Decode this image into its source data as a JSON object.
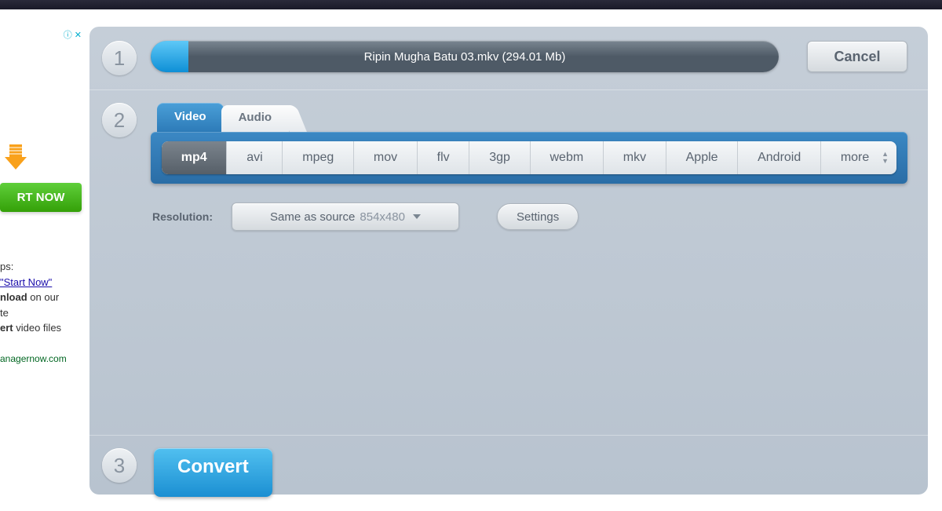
{
  "ad": {
    "badge_info": "ⓘ",
    "badge_close": "✕",
    "start_now": "RT NOW",
    "line_ps": "ps:",
    "link_start": "\"Start Now\"",
    "line2a": "nload",
    "line2b": " on our",
    "line3": "te",
    "line4a": "ert",
    "line4b": " video files",
    "domain": "anagernow.com"
  },
  "step1": {
    "num": "1",
    "file_label": "Ripin Mugha Batu 03.mkv (294.01 Mb)",
    "cancel": "Cancel"
  },
  "step2": {
    "num": "2",
    "tabs": {
      "video": "Video",
      "audio": "Audio"
    },
    "formats": {
      "mp4": "mp4",
      "avi": "avi",
      "mpeg": "mpeg",
      "mov": "mov",
      "flv": "flv",
      "gp3": "3gp",
      "webm": "webm",
      "mkv": "mkv",
      "apple": "Apple",
      "android": "Android",
      "more": "more"
    },
    "resolution_label": "Resolution:",
    "resolution_value": "Same as source",
    "resolution_dim": "854x480",
    "settings": "Settings"
  },
  "step3": {
    "num": "3",
    "convert": "Convert"
  }
}
